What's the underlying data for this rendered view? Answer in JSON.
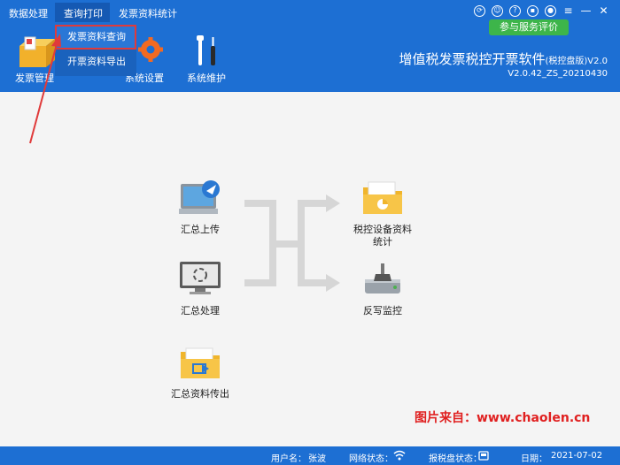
{
  "menubar": [
    "数据处理",
    "查询打印",
    "发票资料统计"
  ],
  "dropdown": [
    "发票资料查询",
    "开票资料导出"
  ],
  "toolbar": {
    "invoice_mgmt": "发票管理",
    "system_settings": "系统设置",
    "system_maintenance": "系统维护"
  },
  "feedback_button": "参与服务评价",
  "app_title": "增值税发票税控开票软件",
  "app_title_suffix": "(税控盘版)V2.0",
  "version": "V2.0.42_ZS_20210430",
  "flow": {
    "upload": "汇总上传",
    "process": "汇总处理",
    "transfer": "汇总资料传出",
    "device_stats_line1": "税控设备资料",
    "device_stats_line2": "统计",
    "writeback": "反写监控"
  },
  "watermark": "图片来自：www.chaolen.cn",
  "status": {
    "user_label": "用户名：",
    "user_value": "张波",
    "network_label": "网络状态：",
    "disk_label": "报税盘状态：",
    "date_label": "日期：",
    "date_value": "2021-07-02"
  },
  "colors": {
    "header_blue": "#1d6fd3",
    "feedback_green": "#3db54a",
    "highlight_red": "#e03a3a"
  }
}
